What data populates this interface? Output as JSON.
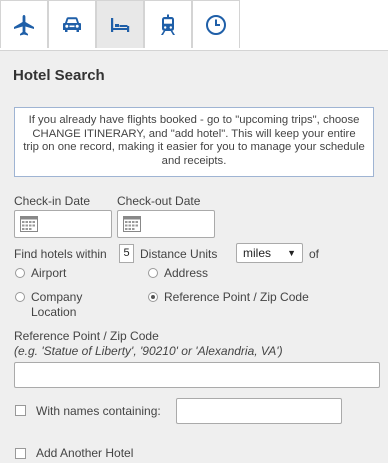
{
  "tabs": [
    {
      "icon": "airplane-icon",
      "label": "Flights"
    },
    {
      "icon": "car-icon",
      "label": "Cars"
    },
    {
      "icon": "bed-icon",
      "label": "Hotels"
    },
    {
      "icon": "train-icon",
      "label": "Rail"
    },
    {
      "icon": "clock-icon",
      "label": "Recent"
    }
  ],
  "panel": {
    "title": "Hotel Search",
    "notice": "If you already have flights booked - go to \"upcoming trips\", choose CHANGE ITINERARY, and \"add hotel\". This will keep your entire trip on one record, making it easier for you to manage your schedule and receipts."
  },
  "dates": {
    "checkin_label": "Check-in Date",
    "checkout_label": "Check-out Date"
  },
  "distance": {
    "find_label": "Find hotels within",
    "value": "5",
    "units_label": "Distance Units",
    "units_selected": "miles",
    "of_label": "of"
  },
  "location_options": {
    "airport": "Airport",
    "address": "Address",
    "company_location": "Company Location",
    "reference_point": "Reference Point / Zip Code",
    "selected": "reference_point"
  },
  "reference": {
    "label": "Reference Point / Zip Code",
    "hint": "(e.g. 'Statue of Liberty', '90210' or 'Alexandria, VA')"
  },
  "names": {
    "label": "With names containing:"
  },
  "add_hotel": {
    "label": "Add Another Hotel"
  },
  "colors": {
    "panel_bg": "#efefef",
    "accent": "#1f5fa8",
    "notice_border": "#9fb4d3"
  }
}
